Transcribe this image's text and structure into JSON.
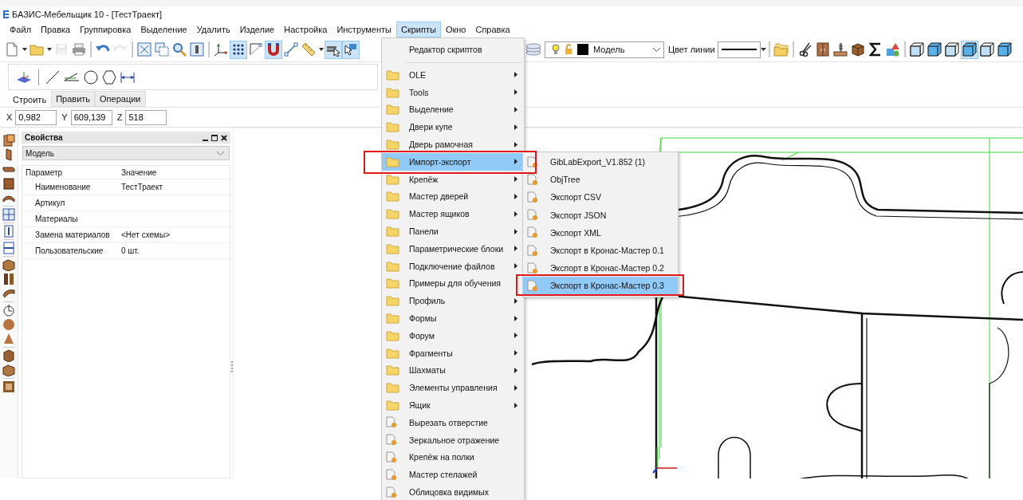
{
  "window": {
    "title": "БАЗИС-Мебельщик 10 - [ТестТраект]"
  },
  "menu_bar": [
    {
      "label": "Файл",
      "selected": false
    },
    {
      "label": "Правка",
      "selected": false
    },
    {
      "label": "Группировка",
      "selected": false
    },
    {
      "label": "Выделение",
      "selected": false
    },
    {
      "label": "Удалить",
      "selected": false
    },
    {
      "label": "Изделие",
      "selected": false
    },
    {
      "label": "Настройка",
      "selected": false
    },
    {
      "label": "Инструменты",
      "selected": false
    },
    {
      "label": "Скрипты",
      "selected": true
    },
    {
      "label": "Окно",
      "selected": false
    },
    {
      "label": "Справка",
      "selected": false
    }
  ],
  "toolbar": {
    "buttons": [
      {
        "kind": "new-file",
        "pressed": false,
        "disabled": false
      },
      {
        "kind": "caret",
        "pressed": false,
        "disabled": false
      },
      {
        "kind": "folder",
        "pressed": false,
        "disabled": false
      },
      {
        "kind": "caret",
        "pressed": false,
        "disabled": false
      },
      {
        "kind": "floppy",
        "pressed": false,
        "disabled": true
      },
      {
        "kind": "printer",
        "pressed": false,
        "disabled": false
      },
      {
        "kind": "undo",
        "pressed": false,
        "disabled": false
      },
      {
        "kind": "redo",
        "pressed": false,
        "disabled": true
      },
      {
        "kind": "zoom-extents",
        "pressed": false,
        "disabled": false
      },
      {
        "kind": "zoom-window",
        "pressed": false,
        "disabled": false
      },
      {
        "kind": "magnifier",
        "pressed": false,
        "disabled": false
      },
      {
        "kind": "view",
        "pressed": false,
        "disabled": false
      },
      {
        "kind": "axes",
        "pressed": false,
        "disabled": false
      },
      {
        "kind": "grid",
        "pressed": true,
        "disabled": false
      },
      {
        "kind": "snap",
        "pressed": false,
        "disabled": false
      },
      {
        "kind": "magnet",
        "pressed": true,
        "disabled": false
      },
      {
        "kind": "line",
        "pressed": false,
        "disabled": false
      },
      {
        "kind": "ruler",
        "pressed": false,
        "disabled": false
      },
      {
        "kind": "caret",
        "pressed": false,
        "disabled": false
      },
      {
        "kind": "layers",
        "pressed": true,
        "disabled": false
      },
      {
        "kind": "cursor",
        "pressed": true,
        "disabled": false
      }
    ],
    "layer_combo": {
      "value": "Модель"
    },
    "line_color_label": "Цвет линии",
    "tools": [
      {
        "kind": "folders",
        "pressed": false,
        "disabled": false
      },
      {
        "kind": "scissors",
        "pressed": false,
        "disabled": false
      },
      {
        "kind": "cabinet",
        "pressed": false,
        "disabled": false
      },
      {
        "kind": "drill",
        "pressed": false,
        "disabled": false
      },
      {
        "kind": "box",
        "pressed": false,
        "disabled": false
      },
      {
        "kind": "sigma",
        "pressed": false,
        "disabled": false
      },
      {
        "kind": "shapes",
        "pressed": false,
        "disabled": false
      },
      {
        "kind": "cube-wire",
        "pressed": false,
        "disabled": false
      },
      {
        "kind": "cube-solid",
        "pressed": false,
        "disabled": false
      },
      {
        "kind": "cube-wire",
        "pressed": false,
        "disabled": false
      },
      {
        "kind": "cube-solid",
        "pressed": true,
        "disabled": false
      },
      {
        "kind": "cube-wire",
        "pressed": false,
        "disabled": false
      },
      {
        "kind": "cube-solid",
        "pressed": false,
        "disabled": false
      }
    ]
  },
  "build_panel": {
    "tabs": [
      {
        "label": "Строить",
        "selected": true
      },
      {
        "label": "Править",
        "selected": false
      },
      {
        "label": "Операции",
        "selected": false
      }
    ]
  },
  "coordinates": [
    {
      "axis": "X",
      "value": "0,982"
    },
    {
      "axis": "Y",
      "value": "609,139"
    },
    {
      "axis": "Z",
      "value": "518"
    }
  ],
  "properties": {
    "title": "Свойства",
    "object": "Модель",
    "columns": [
      "Параметр",
      "Значение"
    ],
    "rows": [
      {
        "name": "Наименование",
        "value": "ТестТраект"
      },
      {
        "name": "Артикул"
      },
      {
        "name": "Материалы"
      },
      {
        "name": "Замена материалов",
        "value": "<Нет схемы>"
      },
      {
        "name": "Пользовательские",
        "value": "0 шт."
      }
    ]
  },
  "scripts_menu": {
    "items": [
      {
        "kind": "plain",
        "label": "Редактор скриптов",
        "submenu": false,
        "selected": false,
        "annotated": false
      },
      {
        "kind": "folder",
        "label": "OLE",
        "submenu": true,
        "selected": false,
        "annotated": false
      },
      {
        "kind": "folder",
        "label": "Tools",
        "submenu": true,
        "selected": false,
        "annotated": false
      },
      {
        "kind": "folder",
        "label": "Выделение",
        "submenu": true,
        "selected": false,
        "annotated": false
      },
      {
        "kind": "folder",
        "label": "Двери купе",
        "submenu": true,
        "selected": false,
        "annotated": false
      },
      {
        "kind": "folder",
        "label": "Дверь рамочная",
        "submenu": true,
        "selected": false,
        "annotated": false
      },
      {
        "kind": "folder",
        "label": "Импорт-экспорт",
        "submenu": true,
        "selected": true,
        "annotated": true
      },
      {
        "kind": "folder",
        "label": "Крепёж",
        "submenu": true,
        "selected": false,
        "annotated": false
      },
      {
        "kind": "folder",
        "label": "Мастер дверей",
        "submenu": true,
        "selected": false,
        "annotated": false
      },
      {
        "kind": "folder",
        "label": "Мастер ящиков",
        "submenu": true,
        "selected": false,
        "annotated": false
      },
      {
        "kind": "folder",
        "label": "Панели",
        "submenu": true,
        "selected": false,
        "annotated": false
      },
      {
        "kind": "folder",
        "label": "Параметрические блоки",
        "submenu": true,
        "selected": false,
        "annotated": false
      },
      {
        "kind": "folder",
        "label": "Подключение файлов",
        "submenu": true,
        "selected": false,
        "annotated": false
      },
      {
        "kind": "folder",
        "label": "Примеры для обучения",
        "submenu": false,
        "selected": false,
        "annotated": false
      },
      {
        "kind": "folder",
        "label": "Профиль",
        "submenu": true,
        "selected": false,
        "annotated": false
      },
      {
        "kind": "folder",
        "label": "Формы",
        "submenu": true,
        "selected": false,
        "annotated": false
      },
      {
        "kind": "folder",
        "label": "Форум",
        "submenu": true,
        "selected": false,
        "annotated": false
      },
      {
        "kind": "folder",
        "label": "Фрагменты",
        "submenu": true,
        "selected": false,
        "annotated": false
      },
      {
        "kind": "folder",
        "label": "Шахматы",
        "submenu": true,
        "selected": false,
        "annotated": false
      },
      {
        "kind": "folder",
        "label": "Элементы управления",
        "submenu": true,
        "selected": false,
        "annotated": false
      },
      {
        "kind": "folder",
        "label": "Ящик",
        "submenu": true,
        "selected": false,
        "annotated": false
      },
      {
        "kind": "script",
        "label": "Вырезать отверстие",
        "submenu": false,
        "selected": false,
        "annotated": false
      },
      {
        "kind": "script",
        "label": "Зеркальное отражение",
        "submenu": false,
        "selected": false,
        "annotated": false
      },
      {
        "kind": "script",
        "label": "Крепёж на полки",
        "submenu": false,
        "selected": false,
        "annotated": false
      },
      {
        "kind": "script",
        "label": "Мастер стелажей",
        "submenu": false,
        "selected": false,
        "annotated": false
      },
      {
        "kind": "script",
        "label": "Облицовка видимых",
        "submenu": false,
        "selected": false,
        "annotated": false
      }
    ]
  },
  "submenu": {
    "items": [
      {
        "kind": "script",
        "label": "GibLabExport_V1.852 (1)",
        "selected": false,
        "annotated": false
      },
      {
        "kind": "script",
        "label": "ObjTree",
        "selected": false,
        "annotated": false
      },
      {
        "kind": "script",
        "label": "Экспорт CSV",
        "selected": false,
        "annotated": false
      },
      {
        "kind": "script",
        "label": "Экспорт JSON",
        "selected": false,
        "annotated": false
      },
      {
        "kind": "script",
        "label": "Экспорт XML",
        "selected": false,
        "annotated": false
      },
      {
        "kind": "script",
        "label": "Экспорт в Кронас-Мастер 0.1",
        "selected": false,
        "annotated": false
      },
      {
        "kind": "script",
        "label": "Экспорт в Кронас-Мастер 0.2",
        "selected": false,
        "annotated": false
      },
      {
        "kind": "script",
        "label": "Экспорт в Кронас-Мастер 0.3",
        "selected": true,
        "annotated": true
      }
    ]
  }
}
